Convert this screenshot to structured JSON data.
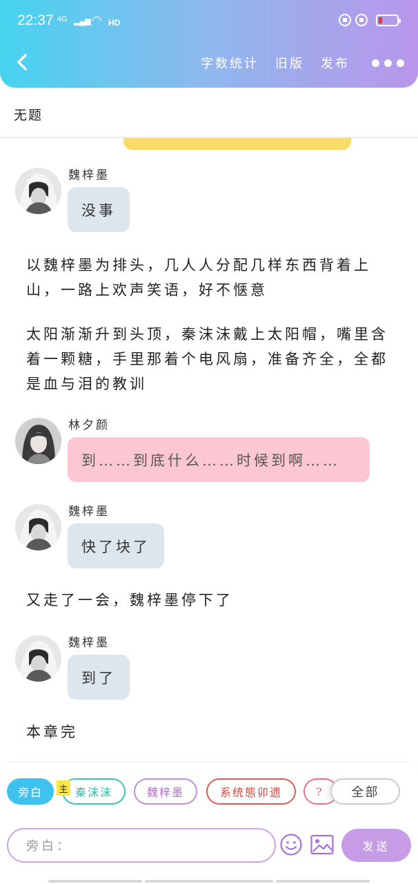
{
  "status_bar": {
    "time": "22:37",
    "network": "4G",
    "hd": "HD"
  },
  "nav": {
    "word_count": "字数统计",
    "old_version": "旧版",
    "publish": "发布"
  },
  "chapter": {
    "title": "无题"
  },
  "content": [
    {
      "type": "message",
      "name": "魏梓墨",
      "text": "没事",
      "bubble": "grey"
    },
    {
      "type": "narration",
      "text": "以魏梓墨为排头，几人人分配几样东西背着上山，一路上欢声笑语，好不惬意"
    },
    {
      "type": "narration",
      "text": "太阳渐渐升到头顶，秦沫沫戴上太阳帽，嘴里含着一颗糖，手里那着个电风扇，准备齐全，全都是血与泪的教训"
    },
    {
      "type": "message",
      "name": "林夕颜",
      "text": "到……到底什么……时候到啊……",
      "bubble": "pink"
    },
    {
      "type": "message",
      "name": "魏梓墨",
      "text": "快了块了",
      "bubble": "grey"
    },
    {
      "type": "narration",
      "text": "又走了一会，魏梓墨停下了"
    },
    {
      "type": "message",
      "name": "魏梓墨",
      "text": "到了",
      "bubble": "grey"
    },
    {
      "type": "narration",
      "text": "本章完"
    }
  ],
  "role_tags": [
    {
      "label": "旁白",
      "selected": true
    },
    {
      "label": "秦沫沫",
      "badge": "主"
    },
    {
      "label": "魏梓墨"
    },
    {
      "label": "系统態卯遗"
    },
    {
      "label": "?"
    },
    {
      "label": "全部"
    }
  ],
  "input": {
    "placeholder": "旁白：",
    "send_label": "发送"
  },
  "colors": {
    "header_gradient_start": "#46d3f0",
    "header_gradient_end": "#b996ea",
    "grey_bubble": "#dde5ee",
    "pink_bubble": "#fcc7d3",
    "send_button": "#c79ce6",
    "highlight_bar": "#fbdc6b"
  }
}
